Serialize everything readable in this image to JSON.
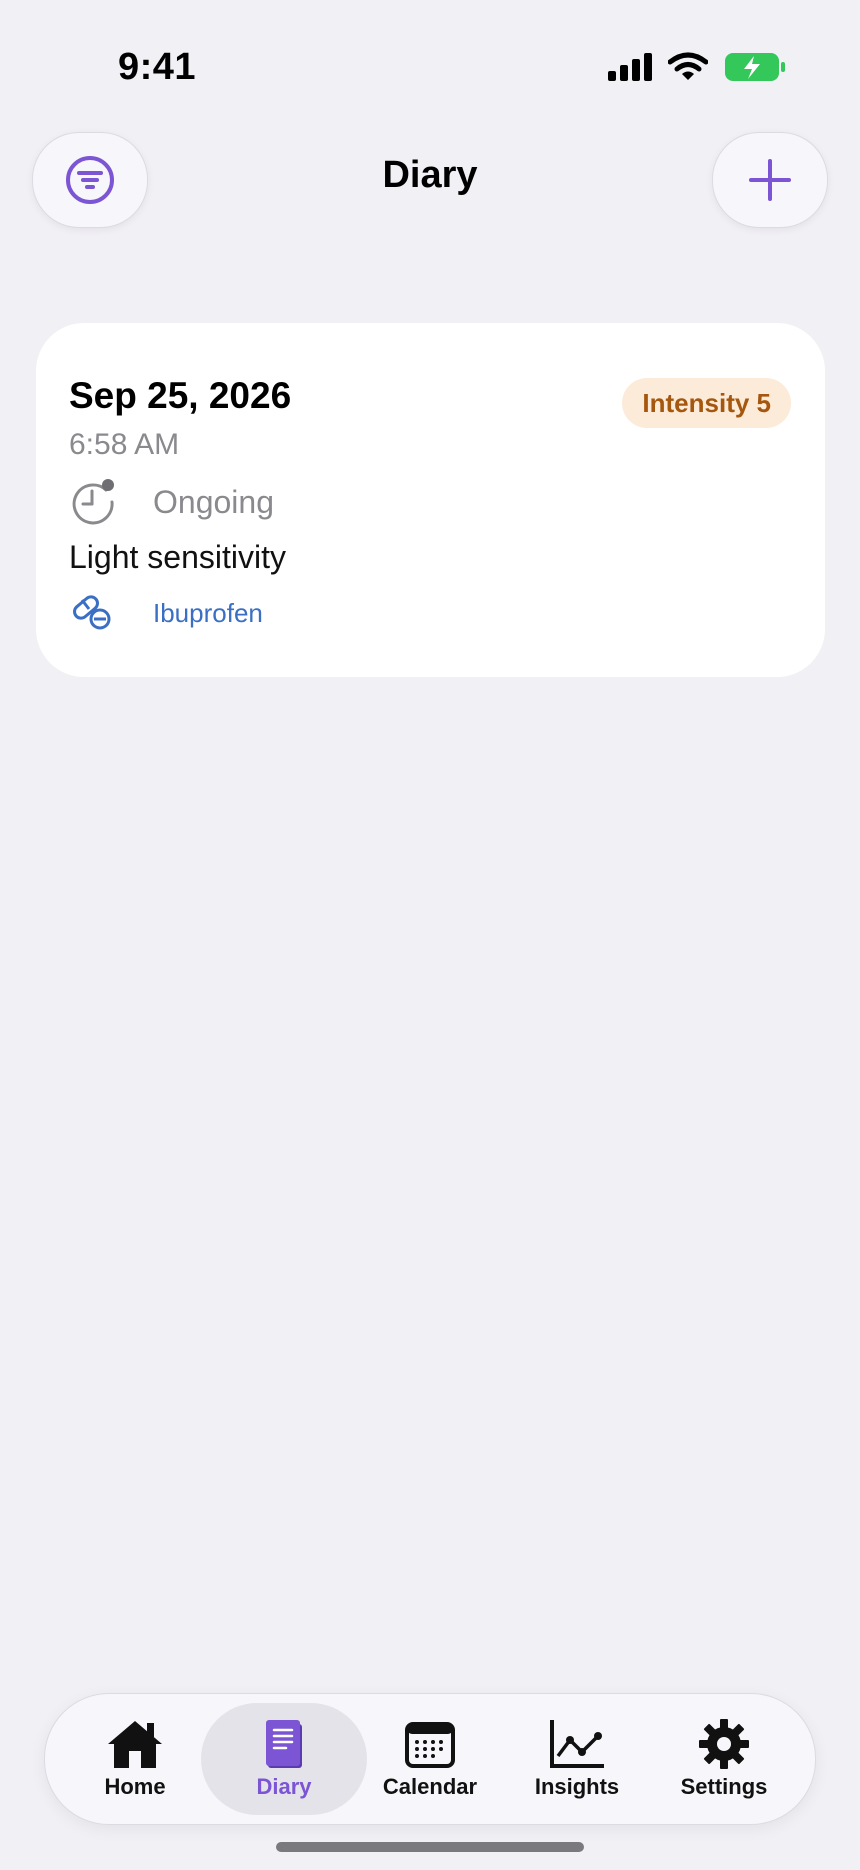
{
  "status_bar": {
    "time": "9:41"
  },
  "header": {
    "title": "Diary"
  },
  "entries": [
    {
      "date": "Sep 25, 2026",
      "time": "6:58 AM",
      "intensity": "Intensity 5",
      "status": "Ongoing",
      "symptom": "Light sensitivity",
      "medication": "Ibuprofen"
    }
  ],
  "tabs": [
    {
      "label": "Home",
      "icon": "house-icon"
    },
    {
      "label": "Diary",
      "icon": "book-icon"
    },
    {
      "label": "Calendar",
      "icon": "calendar-icon"
    },
    {
      "label": "Insights",
      "icon": "chart-icon"
    },
    {
      "label": "Settings",
      "icon": "gear-icon"
    }
  ],
  "active_tab": "Diary",
  "colors": {
    "accent": "#7b55d3",
    "badge_bg": "#fcebd9",
    "badge_text": "#a5570f",
    "link": "#3a6fc4",
    "background": "#f1f0f5"
  }
}
